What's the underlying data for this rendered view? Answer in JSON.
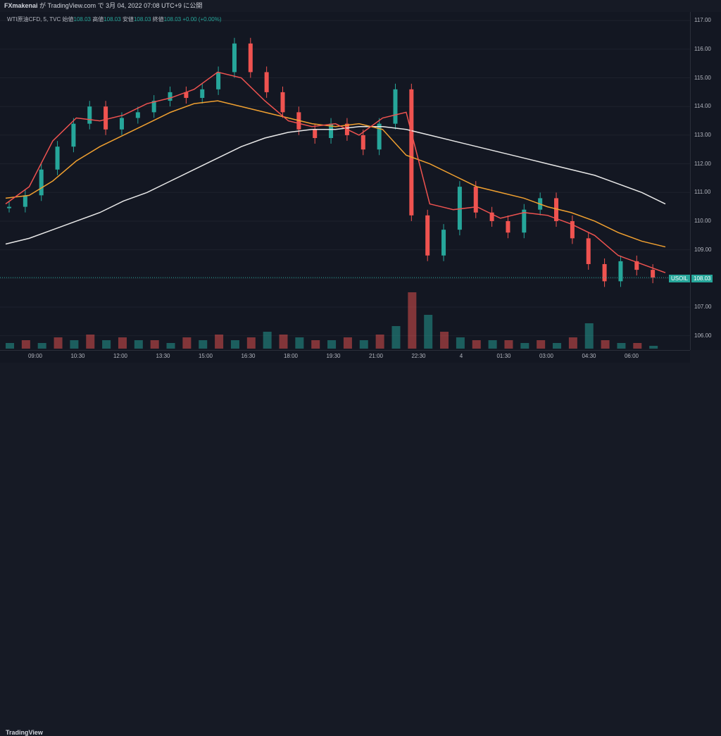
{
  "header": {
    "publisher": "FXmakenai",
    "text": "が TradingView.com で 3月 04, 2022 07:08 UTC+9 に公開"
  },
  "legend": {
    "symbol": "WTI原油CFD, 5, TVC",
    "open_label": "始値",
    "open": "108.03",
    "high_label": "高値",
    "high": "108.03",
    "low_label": "安値",
    "low": "108.03",
    "close_label": "終値",
    "close": "108.03",
    "change": "+0.00 (+0.00%)"
  },
  "price_tag": {
    "symbol": "USOIL",
    "value": "108.03"
  },
  "footer": {
    "brand": "TradingView"
  },
  "colors": {
    "up": "#26a69a",
    "down": "#ef5350",
    "bg": "#131722"
  },
  "chart_data": {
    "type": "line",
    "y_ticks": [
      "117.00",
      "116.00",
      "115.00",
      "114.00",
      "113.00",
      "112.00",
      "111.00",
      "110.00",
      "109.00",
      "108.00",
      "107.00",
      "106.00"
    ],
    "x_ticks": [
      "09:00",
      "10:30",
      "12:00",
      "13:30",
      "15:00",
      "16:30",
      "18:00",
      "19:30",
      "21:00",
      "22:30",
      "4",
      "01:30",
      "03:00",
      "04:30",
      "06:00"
    ],
    "ylim": [
      105.5,
      117.3
    ],
    "series": [
      {
        "color": "#e8e8e8",
        "x": [
          0,
          1,
          2,
          3,
          4,
          5,
          6,
          7,
          8,
          9,
          10,
          11,
          12,
          13,
          14,
          15,
          16,
          17,
          18,
          19,
          20,
          21,
          22,
          23,
          24,
          25,
          26,
          27,
          28
        ],
        "values": [
          109.2,
          109.4,
          109.7,
          110.0,
          110.3,
          110.7,
          111.0,
          111.4,
          111.8,
          112.2,
          112.6,
          112.9,
          113.1,
          113.2,
          113.2,
          113.3,
          113.3,
          113.2,
          113.0,
          112.8,
          112.6,
          112.4,
          112.2,
          112.0,
          111.8,
          111.6,
          111.3,
          111.0,
          110.6
        ]
      },
      {
        "color": "#f0a030",
        "x": [
          0,
          1,
          2,
          3,
          4,
          5,
          6,
          7,
          8,
          9,
          10,
          11,
          12,
          13,
          14,
          15,
          16,
          17,
          18,
          19,
          20,
          21,
          22,
          23,
          24,
          25,
          26,
          27,
          28
        ],
        "values": [
          110.8,
          110.9,
          111.4,
          112.1,
          112.6,
          113.0,
          113.4,
          113.8,
          114.1,
          114.2,
          114.0,
          113.8,
          113.6,
          113.4,
          113.3,
          113.4,
          113.2,
          112.3,
          112.0,
          111.6,
          111.2,
          111.0,
          110.8,
          110.5,
          110.3,
          110.0,
          109.6,
          109.3,
          109.1
        ]
      },
      {
        "color": "#ef5350",
        "x": [
          0,
          1,
          2,
          3,
          4,
          5,
          6,
          7,
          8,
          9,
          10,
          11,
          12,
          13,
          14,
          15,
          16,
          17,
          18,
          19,
          20,
          21,
          22,
          23,
          24,
          25,
          26,
          27,
          28
        ],
        "values": [
          110.6,
          111.2,
          112.8,
          113.6,
          113.5,
          113.7,
          114.1,
          114.3,
          114.6,
          115.2,
          115.0,
          114.2,
          113.5,
          113.3,
          113.4,
          113.0,
          113.6,
          113.8,
          110.6,
          110.4,
          110.5,
          110.1,
          110.3,
          110.2,
          109.9,
          109.5,
          108.8,
          108.5,
          108.2
        ]
      }
    ],
    "candles": [
      110.5,
      110.9,
      111.8,
      112.6,
      113.4,
      114.0,
      113.2,
      113.6,
      113.8,
      114.2,
      114.5,
      114.3,
      114.6,
      115.2,
      116.2,
      115.2,
      114.5,
      113.8,
      113.2,
      112.9,
      113.4,
      113.0,
      112.5,
      113.4,
      114.6,
      110.2,
      108.8,
      109.7,
      111.2,
      110.3,
      110.0,
      109.6,
      110.4,
      110.8,
      110.0,
      109.4,
      108.5,
      107.9,
      108.6,
      108.3,
      108.03
    ],
    "volumes": [
      2,
      3,
      2,
      4,
      3,
      5,
      3,
      4,
      3,
      3,
      2,
      4,
      3,
      5,
      3,
      4,
      6,
      5,
      4,
      3,
      3,
      4,
      3,
      5,
      8,
      20,
      12,
      6,
      4,
      3,
      3,
      3,
      2,
      3,
      2,
      4,
      9,
      3,
      2,
      2,
      1
    ]
  }
}
